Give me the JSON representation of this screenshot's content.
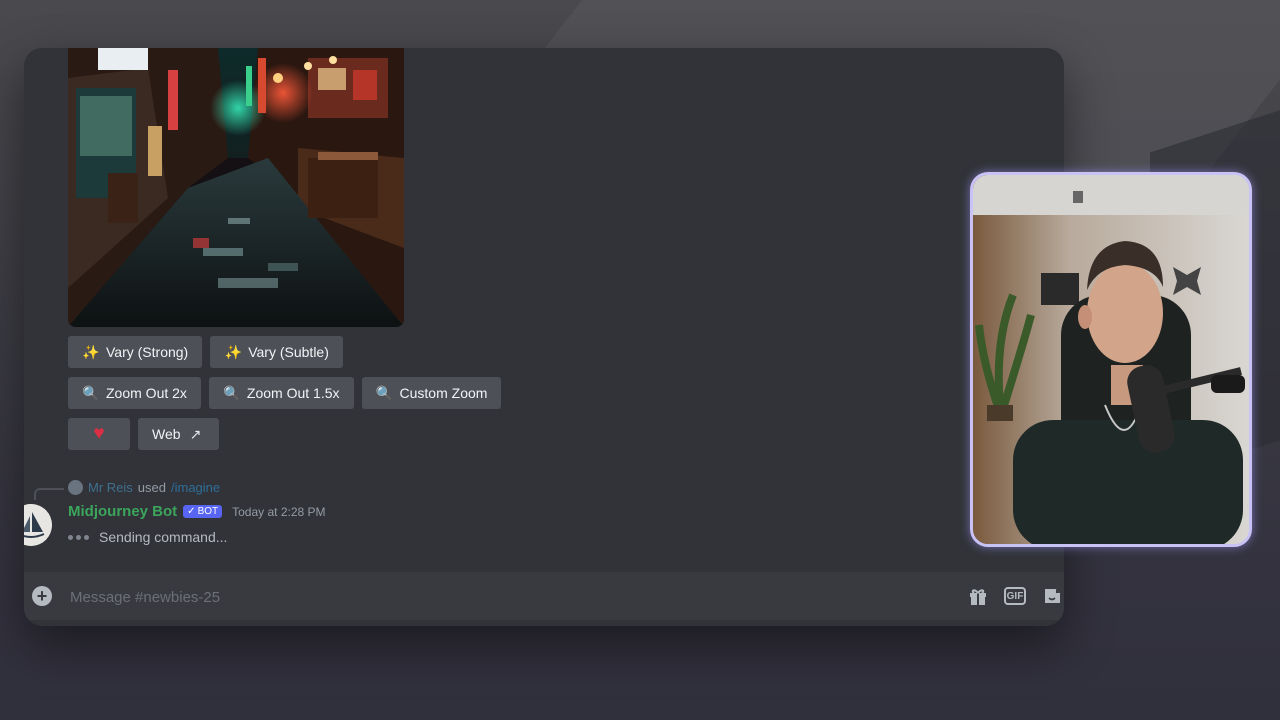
{
  "image_buttons": {
    "vary_strong": "Vary (Strong)",
    "vary_subtle": "Vary (Subtle)",
    "zoom_out_2x": "Zoom Out 2x",
    "zoom_out_1_5x": "Zoom Out 1.5x",
    "custom_zoom": "Custom Zoom",
    "web": "Web"
  },
  "icons": {
    "vary": "✨",
    "zoom": "🔍",
    "heart": "♥",
    "external": "↗"
  },
  "reply": {
    "user": "Mr Reis",
    "verb": "used",
    "command": "/imagine"
  },
  "message": {
    "author": "Midjourney Bot",
    "bot_tag": "BOT",
    "bot_check": "✓",
    "timestamp": "Today at 2:28 PM",
    "status": "Sending command..."
  },
  "composer": {
    "placeholder": "Message #newbies-25",
    "gif_label": "GIF"
  },
  "colors": {
    "window_bg": "#313338",
    "button_bg": "#4e5058",
    "bot_name": "#3ba55c",
    "bot_tag": "#5865f2",
    "webcam_border": "#c9c2f5"
  }
}
